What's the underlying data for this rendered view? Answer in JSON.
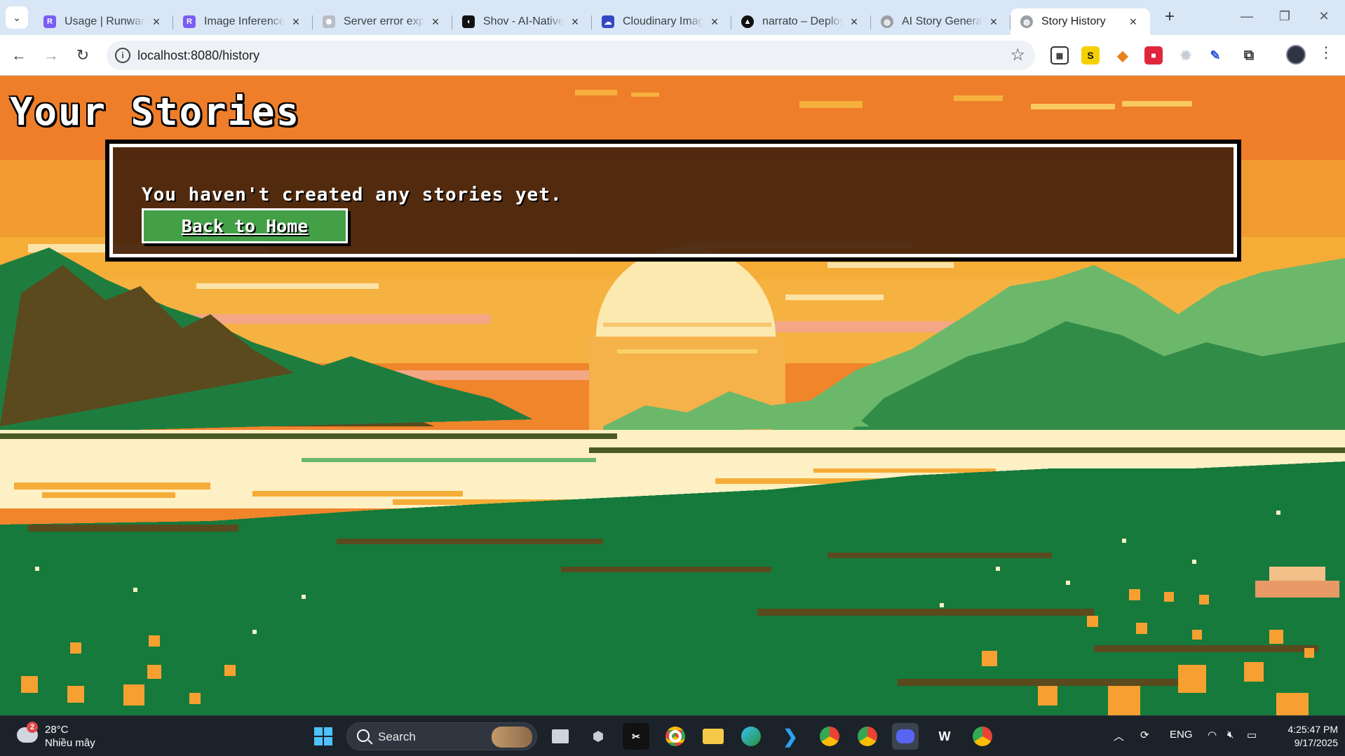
{
  "browser": {
    "tabs": [
      {
        "title": "Usage | Runware",
        "favicon_color": "#7b5cf5"
      },
      {
        "title": "Image Inference",
        "favicon_color": "#7b5cf5"
      },
      {
        "title": "Server error explained",
        "favicon_color": "#9aa0a6"
      },
      {
        "title": "Shov - AI-Native",
        "favicon_color": "#111111"
      },
      {
        "title": "Cloudinary Image",
        "favicon_color": "#3448c5"
      },
      {
        "title": "narrato – Deploy",
        "favicon_color": "#111111"
      },
      {
        "title": "AI Story Generator",
        "favicon_color": "#9aa0a6"
      },
      {
        "title": "Story History",
        "favicon_color": "#9aa0a6",
        "active": true
      }
    ],
    "url": "localhost:8080/history"
  },
  "page": {
    "title": "Your Stories",
    "empty_message": "You haven't created any stories yet.",
    "back_button": "Back to Home"
  },
  "taskbar": {
    "weather_badge": "2",
    "temperature": "28°C",
    "weather_desc": "Nhiều mây",
    "search_label": "Search",
    "language": "ENG",
    "time": "4:25:47 PM",
    "date": "9/17/2025"
  }
}
